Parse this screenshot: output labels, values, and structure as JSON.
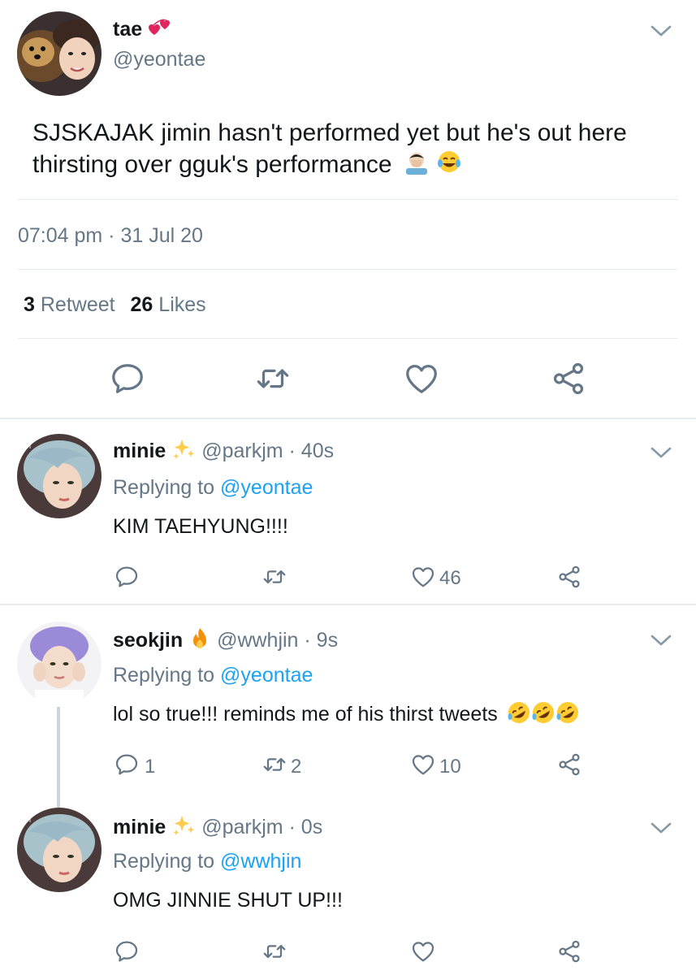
{
  "main_tweet": {
    "display_name": "tae",
    "name_emoji": "revolving-hearts",
    "handle": "@yeontae",
    "text_line1": "SJSKAJAK jimin hasn't performed yet but he's out here",
    "text_line2": "thirsting over gguk's performance",
    "text_emojis": [
      "facepalm",
      "tears-of-joy"
    ],
    "timestamp": "07:04 pm · 31 Jul 20",
    "retweet_count": "3",
    "retweet_label": "Retweet",
    "like_count": "26",
    "like_label": "Likes"
  },
  "replies": [
    {
      "display_name": "minie",
      "name_emoji": "sparkles",
      "handle_time": "@parkjm · 40s",
      "replying_label": "Replying to",
      "replying_to": "@yeontae",
      "text": "KIM TAEHYUNG!!!!",
      "reply_count": "",
      "retweet_count": "",
      "like_count": "46"
    },
    {
      "display_name": "seokjin",
      "name_emoji": "fire",
      "handle_time": "@wwhjin · 9s",
      "replying_label": "Replying to",
      "replying_to": "@yeontae",
      "text": "lol so true!!! reminds me of his thirst tweets",
      "text_emojis": [
        "rofl",
        "rofl",
        "rofl"
      ],
      "reply_count": "1",
      "retweet_count": "2",
      "like_count": "10"
    },
    {
      "display_name": "minie",
      "name_emoji": "sparkles",
      "handle_time": "@parkjm · 0s",
      "replying_label": "Replying to",
      "replying_to": "@wwhjin",
      "text": "OMG JINNIE SHUT UP!!!",
      "reply_count": "",
      "retweet_count": "",
      "like_count": ""
    }
  ],
  "colors": {
    "text": "#14171a",
    "muted": "#657786",
    "link": "#1da1f2",
    "divider": "#e6ecf0",
    "icon": "#657786"
  }
}
